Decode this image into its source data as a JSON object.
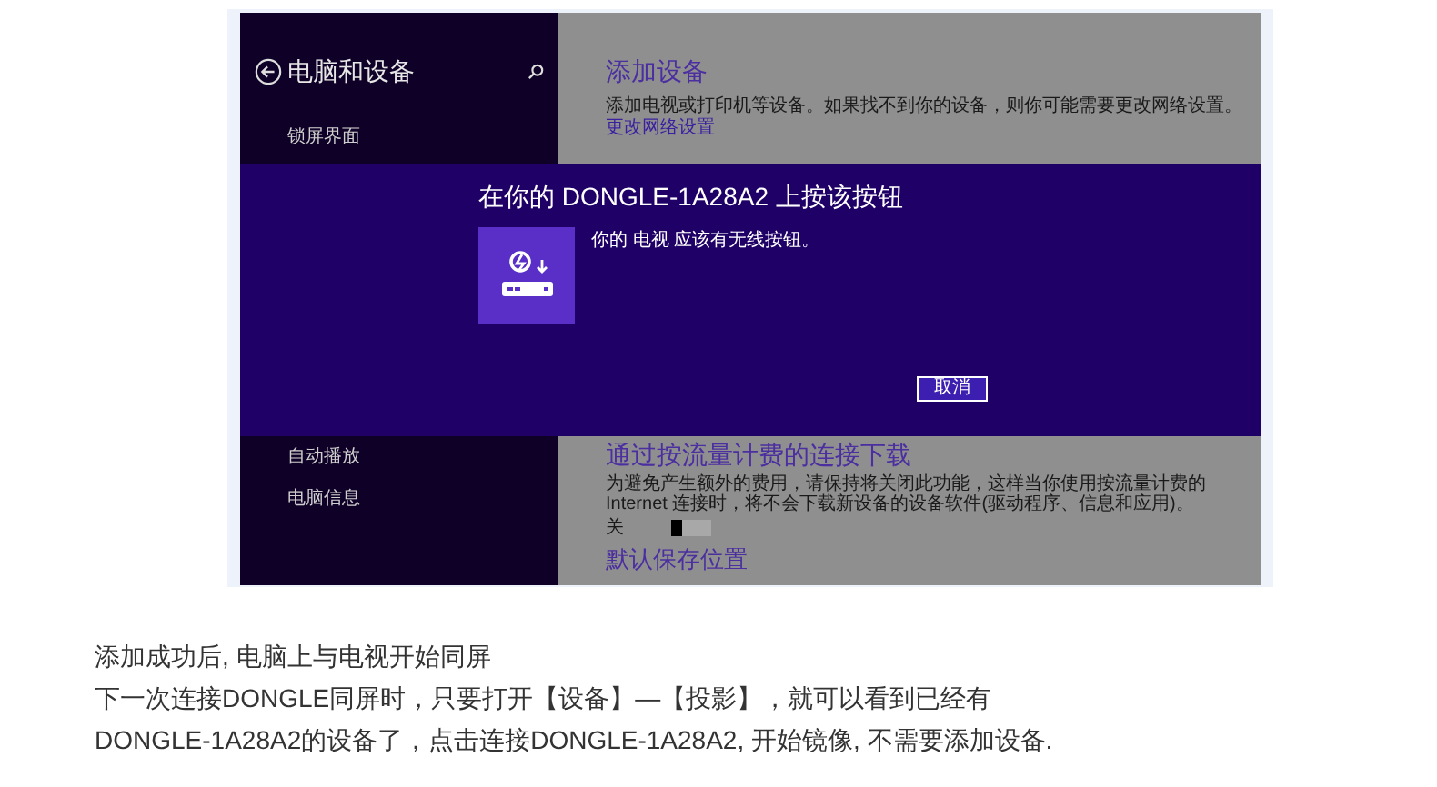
{
  "sidebar": {
    "title": "电脑和设备",
    "items": [
      {
        "label": "锁屏界面",
        "selected": false
      },
      {
        "label": "自动播放",
        "selected": false
      },
      {
        "label": "电脑信息",
        "selected": false
      }
    ]
  },
  "content": {
    "heading": "添加设备",
    "description": "添加电视或打印机等设备。如果找不到你的设备，则你可能需要更改网络设置。",
    "link": "更改网络设置",
    "metered": {
      "heading": "通过按流量计费的连接下载",
      "description": "为避免产生额外的费用，请保持将关闭此功能，这样当你使用按流量计费的 Internet 连接时，将不会下载新设备的设备软件(驱动程序、信息和应用)。",
      "toggle_label": "关",
      "on": false
    },
    "save_heading": "默认保存位置"
  },
  "dialog": {
    "title": "在你的 DONGLE-1A28A2 上按该按钮",
    "message": "你的 电视 应该有无线按钮。",
    "button": "取消"
  },
  "caption": [
    "添加成功后, 电脑上与电视开始同屏",
    "下一次连接DONGLE同屏时，只要打开【设备】—【投影】，就可以看到已经有",
    "DONGLE-1A28A2的设备了，点击连接DONGLE-1A28A2, 开始镜像, 不需要添加设备."
  ]
}
